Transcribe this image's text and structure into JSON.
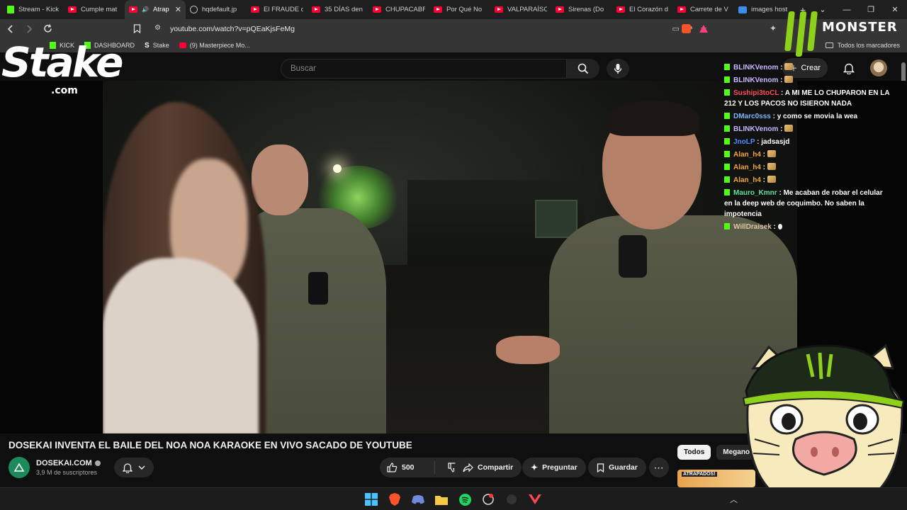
{
  "browser": {
    "tabs": [
      {
        "label": "Stream - Kick",
        "icon": "kick-icon"
      },
      {
        "label": "Cumple mat",
        "icon": "youtube-icon"
      },
      {
        "label": "Atrap",
        "icon": "youtube-icon",
        "active": true
      },
      {
        "label": "hqdefault.jp",
        "icon": "globe-icon"
      },
      {
        "label": "El FRAUDE d",
        "icon": "youtube-icon"
      },
      {
        "label": "35 DÍAS den",
        "icon": "youtube-icon"
      },
      {
        "label": "CHUPACABR",
        "icon": "youtube-icon"
      },
      {
        "label": "Por Qué No",
        "icon": "youtube-icon"
      },
      {
        "label": "VALPARAÍSO",
        "icon": "youtube-icon"
      },
      {
        "label": "Sirenas (Do",
        "icon": "youtube-icon"
      },
      {
        "label": "El Corazón d",
        "icon": "youtube-icon"
      },
      {
        "label": "Carrete de V",
        "icon": "youtube-icon"
      },
      {
        "label": "images host",
        "icon": "image-icon"
      }
    ],
    "new_tab": "+",
    "url": "youtube.com/watch?v=pQEaKjsFeMg",
    "bookmarks": [
      {
        "label": "KICK",
        "icon": "kick-icon"
      },
      {
        "label": "DASHBOARD",
        "icon": "kick-icon"
      },
      {
        "label": "Stake",
        "icon": "stake-icon"
      },
      {
        "label": "(9) Masterpiece Mo...",
        "icon": "youtube-icon"
      }
    ],
    "all_bookmarks": "Todos los marcadores"
  },
  "youtube": {
    "search_placeholder": "Buscar",
    "create_label": "Crear",
    "video_title": "DOSEKAI INVENTA EL BAILE DEL NOA NOA KARAOKE EN VIVO SACADO DE YOUTUBE",
    "channel_name": "DOSEKAI.COM",
    "subscribers": "3,9 M de suscriptores",
    "likes": "500",
    "share_label": "Compartir",
    "ask_label": "Preguntar",
    "save_label": "Guardar",
    "chips": [
      "Todos",
      "Meganot"
    ],
    "preview_thumb_text": "ATRAPADOS!"
  },
  "overlay": {
    "stake_word": "Stake",
    "stake_domain": ".com",
    "monster_text": "MONSTER",
    "chat": [
      {
        "user": "BLINKVenom",
        "color": "#c9b6ff",
        "text": "",
        "emote": true
      },
      {
        "user": "BLINKVenom",
        "color": "#c9b6ff",
        "text": "",
        "emote": true
      },
      {
        "user": "Sushipi3toCL",
        "color": "#ff4a5a",
        "text": "A MI ME LO CHUPARON EN LA 212 Y LOS PACOS NO ISIERON NADA",
        "emote": false
      },
      {
        "user": "DMarc0sss",
        "color": "#7db6ff",
        "text": "y como se movia la wea",
        "emote": false
      },
      {
        "user": "BLINKVenom",
        "color": "#c9b6ff",
        "text": "",
        "emote": true
      },
      {
        "user": "JnoLP",
        "color": "#4e8dff",
        "text": "jadsasjd",
        "emote": false
      },
      {
        "user": "Alan_h4",
        "color": "#f0a53a",
        "text": "",
        "emote": true
      },
      {
        "user": "Alan_h4",
        "color": "#f0a53a",
        "text": "",
        "emote": true
      },
      {
        "user": "Alan_h4",
        "color": "#f0a53a",
        "text": "",
        "emote": true
      },
      {
        "user": "Mauro_Kmnr",
        "color": "#5fe0a0",
        "text": "Me acaban de robar el celular en la deep web de coquimbo. No saben la impotencia",
        "emote": false
      },
      {
        "user": "WillDraisek",
        "color": "#d8c8a8",
        "text": "",
        "emote": "small"
      }
    ]
  },
  "colors": {
    "youtube_red": "#ff0033",
    "kick_green": "#53fc18",
    "monster_green": "#8fd11a"
  }
}
